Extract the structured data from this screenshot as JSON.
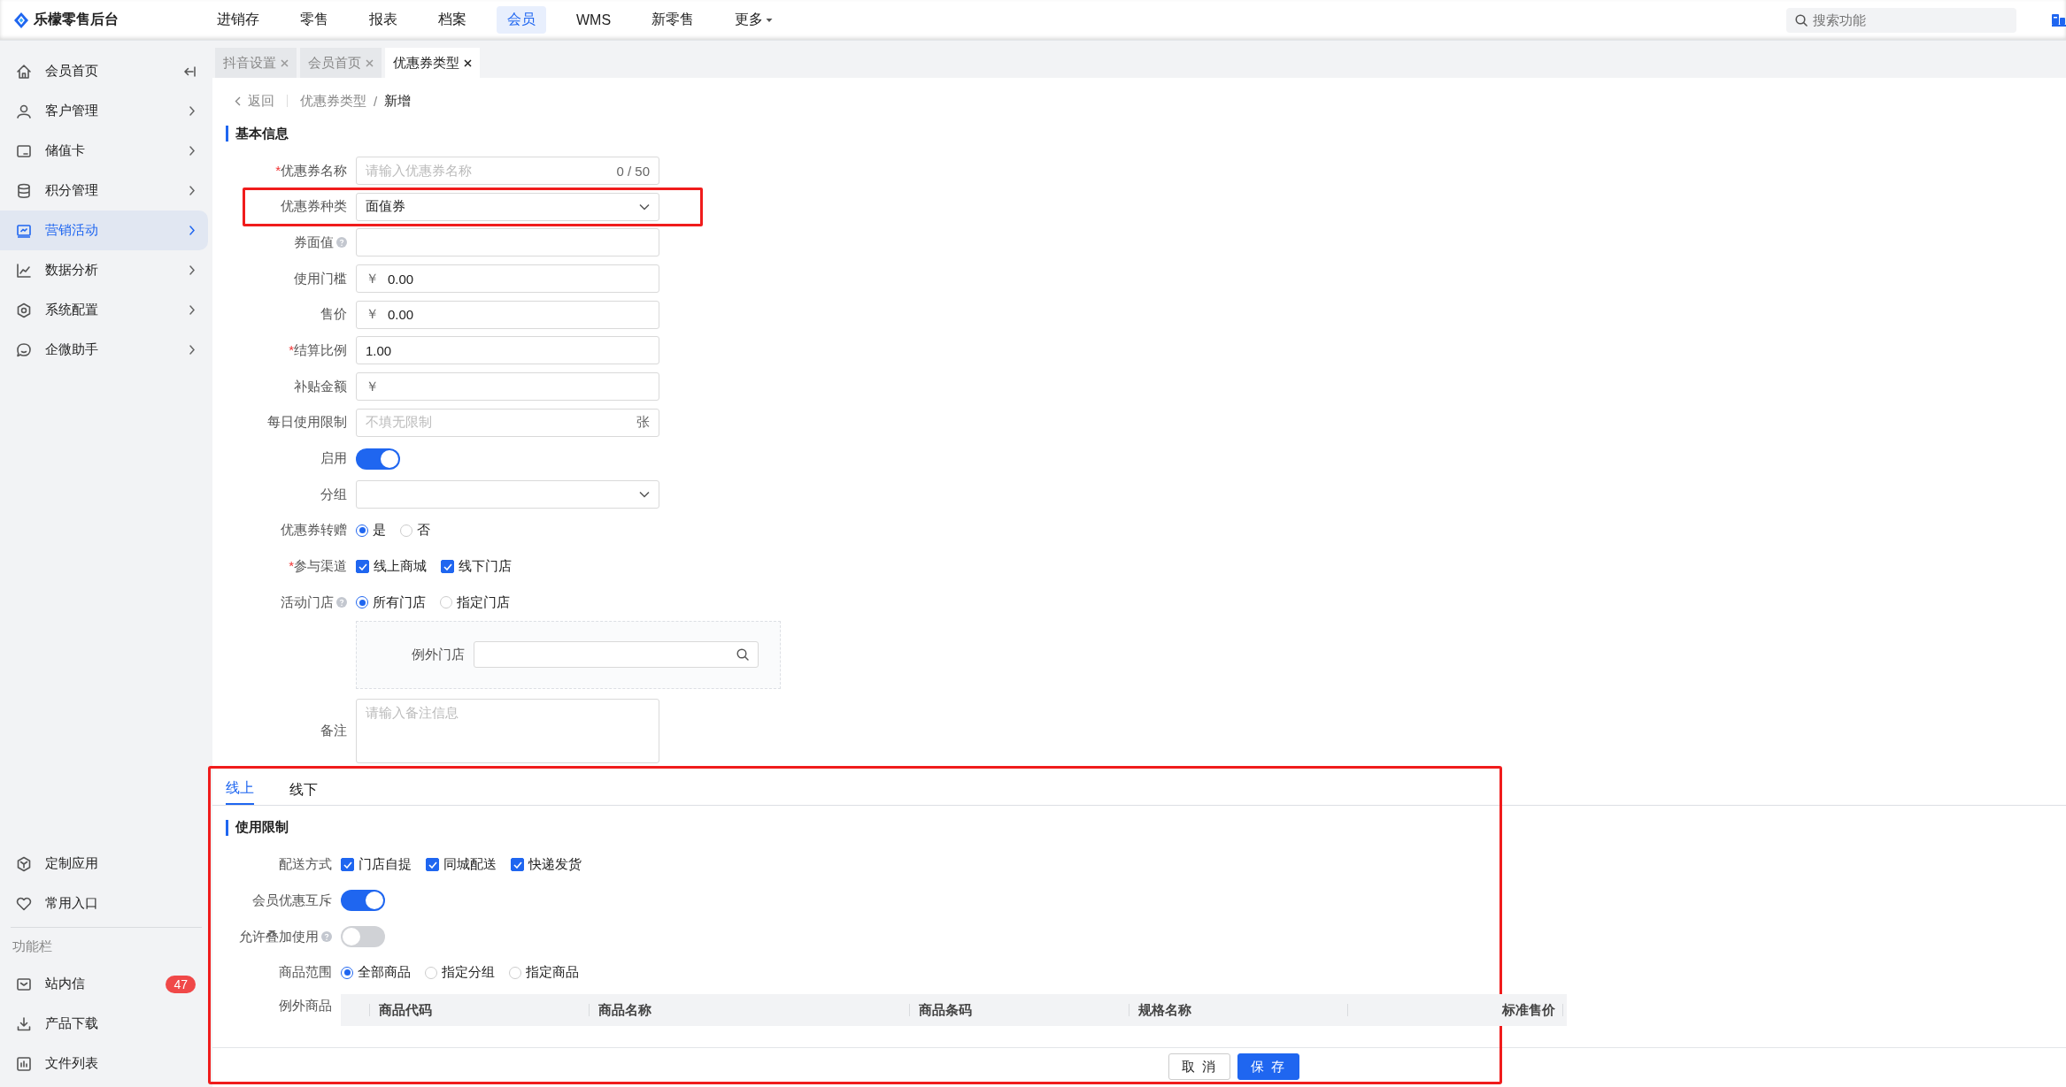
{
  "app": {
    "title": "乐檬零售后台"
  },
  "top_nav": [
    {
      "label": "进销存",
      "selected": false,
      "menu": false
    },
    {
      "label": "零售",
      "selected": false,
      "menu": false
    },
    {
      "label": "报表",
      "selected": false,
      "menu": false
    },
    {
      "label": "档案",
      "selected": false,
      "menu": false
    },
    {
      "label": "会员",
      "selected": true,
      "menu": false
    },
    {
      "label": "WMS",
      "selected": false,
      "menu": false
    },
    {
      "label": "新零售",
      "selected": false,
      "menu": false
    },
    {
      "label": "更多",
      "selected": false,
      "menu": true
    }
  ],
  "search": {
    "placeholder": "搜索功能"
  },
  "sidebar": {
    "items": [
      {
        "label": "会员首页",
        "kind": "collapse",
        "selected": false
      },
      {
        "label": "客户管理",
        "kind": "menu",
        "selected": false
      },
      {
        "label": "储值卡",
        "kind": "menu",
        "selected": false
      },
      {
        "label": "积分管理",
        "kind": "menu",
        "selected": false
      },
      {
        "label": "营销活动",
        "kind": "menu",
        "selected": true
      },
      {
        "label": "数据分析",
        "kind": "menu",
        "selected": false
      },
      {
        "label": "系统配置",
        "kind": "menu",
        "selected": false
      },
      {
        "label": "企微助手",
        "kind": "menu",
        "selected": false
      }
    ],
    "bottom_items": [
      {
        "label": "定制应用"
      },
      {
        "label": "常用入口"
      }
    ],
    "section_title": "功能栏",
    "section_items": [
      {
        "label": "站内信",
        "badge": "47"
      },
      {
        "label": "产品下载"
      },
      {
        "label": "文件列表"
      }
    ]
  },
  "doc_tabs": [
    {
      "label": "抖音设置",
      "selected": false
    },
    {
      "label": "会员首页",
      "selected": false
    },
    {
      "label": "优惠券类型",
      "selected": true
    }
  ],
  "breadcrumb": {
    "back": "返回",
    "separator": "/",
    "path": [
      "优惠券类型",
      "新增"
    ]
  },
  "required_mark": "*",
  "basic_section": {
    "title": "基本信息",
    "fields": [
      {
        "label": "优惠券名称",
        "required": true,
        "help": false,
        "highlighted": false,
        "kind": "text",
        "placeholder": "请输入优惠券名称",
        "suffix": "0 / 50"
      },
      {
        "label": "优惠券种类",
        "required": false,
        "help": false,
        "highlighted": true,
        "kind": "select",
        "value": "面值券"
      },
      {
        "label": "券面值",
        "required": false,
        "help": true,
        "highlighted": false,
        "kind": "text"
      },
      {
        "label": "使用门槛",
        "required": false,
        "help": false,
        "highlighted": false,
        "kind": "text",
        "prefix": "￥",
        "value": "0.00"
      },
      {
        "label": "售价",
        "required": false,
        "help": false,
        "highlighted": false,
        "kind": "text",
        "prefix": "￥",
        "value": "0.00"
      },
      {
        "label": "结算比例",
        "required": true,
        "help": false,
        "highlighted": false,
        "kind": "text",
        "value": "1.00"
      },
      {
        "label": "补贴金额",
        "required": false,
        "help": false,
        "highlighted": false,
        "kind": "text",
        "prefix": "￥"
      },
      {
        "label": "每日使用限制",
        "required": false,
        "help": false,
        "highlighted": false,
        "kind": "text",
        "placeholder": "不填无限制",
        "suffix": "张"
      },
      {
        "label": "启用",
        "required": false,
        "help": false,
        "highlighted": false,
        "kind": "switch",
        "on": true
      },
      {
        "label": "分组",
        "required": false,
        "help": false,
        "highlighted": false,
        "kind": "select"
      },
      {
        "label": "优惠券转赠",
        "required": false,
        "help": false,
        "highlighted": false,
        "kind": "radio",
        "options": [
          {
            "label": "是",
            "selected": true
          },
          {
            "label": "否",
            "selected": false
          }
        ]
      },
      {
        "label": "参与渠道",
        "required": true,
        "help": false,
        "highlighted": false,
        "kind": "checkbox",
        "options": [
          {
            "label": "线上商城",
            "checked": true
          },
          {
            "label": "线下门店",
            "checked": true
          }
        ]
      },
      {
        "label": "活动门店",
        "required": false,
        "help": true,
        "highlighted": false,
        "kind": "radio",
        "options": [
          {
            "label": "所有门店",
            "selected": true
          },
          {
            "label": "指定门店",
            "selected": false
          }
        ]
      },
      {
        "label": "例外门店",
        "required": false,
        "help": false,
        "highlighted": false,
        "kind": "store_box"
      },
      {
        "label": "备注",
        "required": false,
        "help": false,
        "highlighted": false,
        "kind": "textarea",
        "placeholder": "请输入备注信息"
      }
    ]
  },
  "usage_panel": {
    "highlighted": true,
    "tabs": [
      {
        "label": "线上",
        "selected": true
      },
      {
        "label": "线下",
        "selected": false
      }
    ],
    "title": "使用限制",
    "fields": [
      {
        "label": "配送方式",
        "help": false,
        "kind": "checkbox",
        "options": [
          {
            "label": "门店自提",
            "checked": true
          },
          {
            "label": "同城配送",
            "checked": true
          },
          {
            "label": "快递发货",
            "checked": true
          }
        ]
      },
      {
        "label": "会员优惠互斥",
        "help": false,
        "kind": "switch",
        "on": true
      },
      {
        "label": "允许叠加使用",
        "help": true,
        "kind": "switch",
        "on": false
      },
      {
        "label": "商品范围",
        "help": false,
        "kind": "radio",
        "options": [
          {
            "label": "全部商品",
            "selected": true
          },
          {
            "label": "指定分组",
            "selected": false
          },
          {
            "label": "指定商品",
            "selected": false
          }
        ]
      },
      {
        "label": "例外商品",
        "help": false,
        "kind": "table",
        "columns": [
          "商品代码",
          "商品名称",
          "商品条码",
          "规格名称",
          "标准售价"
        ]
      }
    ]
  },
  "actions": [
    {
      "label": "取 消",
      "kind": "secondary"
    },
    {
      "label": "保 存",
      "kind": "primary"
    }
  ]
}
